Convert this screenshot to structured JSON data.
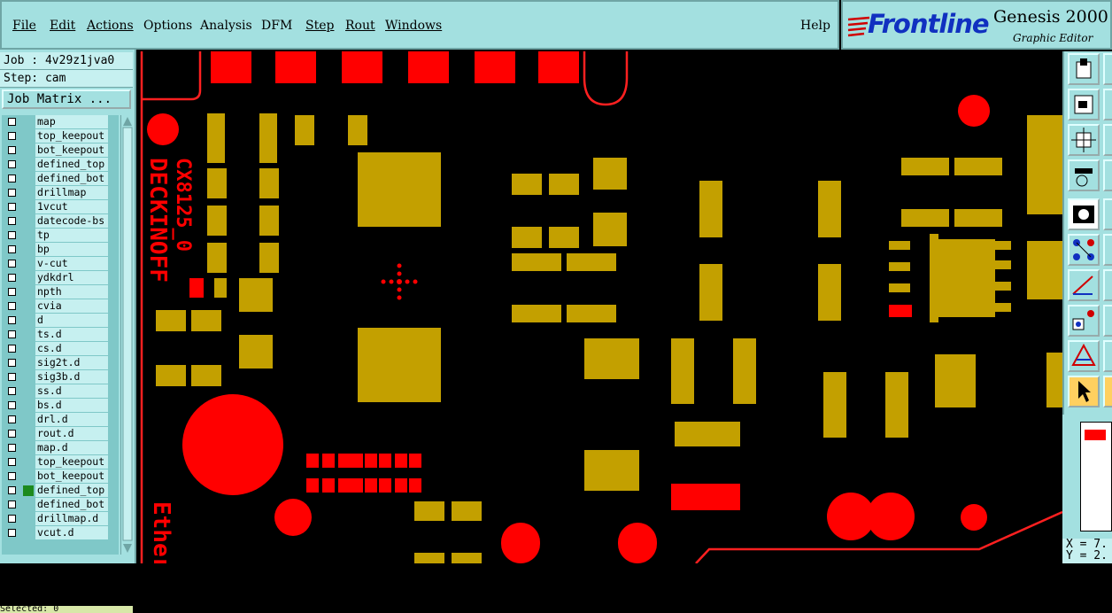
{
  "menu": {
    "file": "File",
    "edit": "Edit",
    "actions": "Actions",
    "options": "Options",
    "analysis": "Analysis",
    "dfm": "DFM",
    "step": "Step",
    "rout": "Rout",
    "windows": "Windows",
    "help": "Help"
  },
  "logo": {
    "word": "Frontline",
    "title": "Genesis 2000",
    "subtitle": "Graphic Editor"
  },
  "job_info": {
    "job": "Job : 4v29z1jva0",
    "step": "Step: cam",
    "matrix_button": "Job Matrix ..."
  },
  "layers": [
    "map",
    "top_keepout",
    "bot_keepout",
    "defined_top",
    "defined_bot",
    "drillmap",
    "1vcut",
    "datecode-bs",
    "tp",
    "bp",
    "v-cut",
    "ydkdrl",
    "npth",
    "cvia",
    "d",
    "ts.d",
    "cs.d",
    "sig2t.d",
    "sig3b.d",
    "ss.d",
    "bs.d",
    "drl.d",
    "rout.d",
    "map.d",
    "top_keepout",
    "bot_keepout",
    "defined_top",
    "defined_bot",
    "drillmap.d",
    "vcut.d"
  ],
  "active_layer_index": 26,
  "status_text": "Selected: 0",
  "board_text": {
    "part": "CX8125_0",
    "brand": "DECKINOFF",
    "net": "Ether"
  },
  "coords": {
    "x": "X = 7.",
    "y": "Y = 2."
  },
  "colors": {
    "panel": "#a3e0e0",
    "copper": "#c3a000",
    "feature": "#ff0000",
    "background": "#000000"
  },
  "tools": [
    "save-icon",
    "zoom-window-icon",
    "fit-icon",
    "settings-icon",
    "feature-display-icon",
    "snap-icon",
    "measure-icon",
    "add-pad-icon",
    "triangle-icon",
    "pointer-icon"
  ]
}
